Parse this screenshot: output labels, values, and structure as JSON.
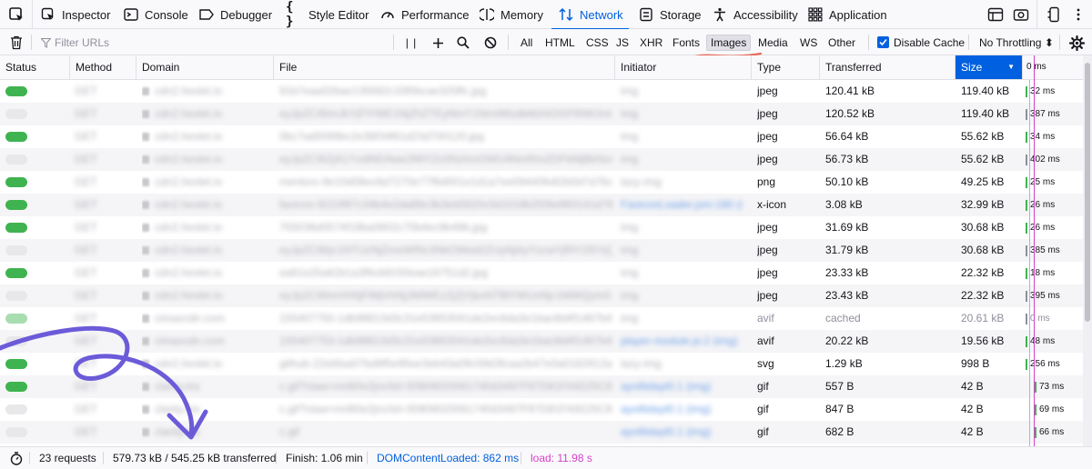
{
  "tabs": [
    {
      "label": "Inspector",
      "icon": "inspector-icon"
    },
    {
      "label": "Console",
      "icon": "console-icon"
    },
    {
      "label": "Debugger",
      "icon": "debugger-icon"
    },
    {
      "label": "Style Editor",
      "icon": "style-editor-icon"
    },
    {
      "label": "Performance",
      "icon": "performance-icon"
    },
    {
      "label": "Memory",
      "icon": "memory-icon"
    },
    {
      "label": "Network",
      "icon": "network-icon",
      "selected": true
    },
    {
      "label": "Storage",
      "icon": "storage-icon"
    },
    {
      "label": "Accessibility",
      "icon": "accessibility-icon"
    },
    {
      "label": "Application",
      "icon": "application-icon"
    }
  ],
  "toolbar": {
    "filter_placeholder": "Filter URLs",
    "type_filters": [
      "All",
      "HTML",
      "CSS",
      "JS",
      "XHR",
      "Fonts",
      "Images",
      "Media",
      "WS",
      "Other"
    ],
    "active_filter": "Images",
    "disable_cache_label": "Disable Cache",
    "disable_cache_checked": true,
    "throttling_label": "No Throttling ⬍"
  },
  "columns": {
    "status": "Status",
    "method": "Method",
    "domain": "Domain",
    "file": "File",
    "initiator": "Initiator",
    "type": "Type",
    "transferred": "Transferred",
    "size": "Size",
    "waterfall": "0 ms"
  },
  "colors": {
    "accent": "#0060df",
    "status_ok": "#3fb34f",
    "load_marker": "#d541c8",
    "dcl_marker": "#9db7f0",
    "annotation_arrow": "#6b5bd9",
    "annotation_underline": "#e86a5a"
  },
  "rows": [
    {
      "status": "green",
      "method": "GET",
      "domain": "cdn2.hexlet.io",
      "file": "91b7eaa02bae135692c33f0bcae325ffc.jpg",
      "initiator": "img",
      "initiator_link": false,
      "type": "jpeg",
      "transferred": "120.41 kB",
      "size": "119.40 kB",
      "time": "32 ms",
      "bar_color": "#3fb34f"
    },
    {
      "status": "grey",
      "method": "GET",
      "domain": "cdn2.hexlet.io",
      "file": "eyJpZCI6ImJkYjFlYWE1NjZhZTEyNmY1NmIiMzdkMzhiOGFlNWJmIn0.mpeeZjI",
      "initiator": "img",
      "initiator_link": false,
      "type": "jpeg",
      "transferred": "120.52 kB",
      "size": "119.40 kB",
      "time": "387 ms",
      "bar_color": "#8f8f9d"
    },
    {
      "status": "green",
      "method": "GET",
      "domain": "cdn2.hexlet.io",
      "file": "0bc7ad0099bc2e38f34f61d23d700120.jpg",
      "initiator": "img",
      "initiator_link": false,
      "type": "jpeg",
      "transferred": "56.64 kB",
      "size": "55.62 kB",
      "time": "34 ms",
      "bar_color": "#3fb34f"
    },
    {
      "status": "grey",
      "method": "GET",
      "domain": "cdn2.hexlet.io",
      "file": "eyJpZCI6ZjA1YzdlNDAwe2MiYZc0NzhmOWU4NmRmZDFkMjBkNzAxMzEzIn0.mpeeZjI",
      "initiator": "img",
      "initiator_link": false,
      "type": "jpeg",
      "transferred": "56.73 kB",
      "size": "55.62 kB",
      "time": "402 ms",
      "bar_color": "#8f8f9d"
    },
    {
      "status": "green",
      "method": "GET",
      "domain": "cdn2.hexlet.io",
      "file": "mentors-9e10d08ec6d7270e77f6d001e1d1a7ee09440fe82b0d7d76c2c2",
      "initiator": "lazy-img",
      "initiator_link": false,
      "type": "png",
      "transferred": "50.10 kB",
      "size": "49.25 kB",
      "time": "25 ms",
      "bar_color": "#3fb34f"
    },
    {
      "status": "green",
      "method": "GET",
      "domain": "cdn2.hexlet.io",
      "file": "favicon-9210f97c34b4e2da89c3b3eb5820c0d1018b2f26e993141d782e",
      "initiator": "FaviconLoader.jsm:180 (i",
      "initiator_link": true,
      "type": "x-icon",
      "transferred": "3.08 kB",
      "size": "32.99 kB",
      "time": "26 ms",
      "bar_color": "#3fb34f"
    },
    {
      "status": "green",
      "method": "GET",
      "domain": "cdn2.hexlet.io",
      "file": "755036d0574f18ba0602c70b4ec9b49b.jpg",
      "initiator": "img",
      "initiator_link": false,
      "type": "jpeg",
      "transferred": "31.69 kB",
      "size": "30.68 kB",
      "time": "26 ms",
      "bar_color": "#3fb34f"
    },
    {
      "status": "grey",
      "method": "GET",
      "domain": "cdn2.hexlet.io",
      "file": "eyJpZCI6Ijc1NTUzNjZmeWRlc3NkOWed2ZUyNjAyYzcwYjRlY2I5YjQ5YiIn0.mpeeZjI",
      "initiator": "img",
      "initiator_link": false,
      "type": "jpeg",
      "transferred": "31.79 kB",
      "size": "30.68 kB",
      "time": "385 ms",
      "bar_color": "#8f8f9d"
    },
    {
      "status": "green",
      "method": "GET",
      "domain": "cdn2.hexlet.io",
      "file": "ea61e25a62b1a3f6cb9150eae16751d2.jpg",
      "initiator": "img",
      "initiator_link": false,
      "type": "jpeg",
      "transferred": "23.33 kB",
      "size": "22.32 kB",
      "time": "18 ms",
      "bar_color": "#3fb34f"
    },
    {
      "status": "grey",
      "method": "GET",
      "domain": "cdn2.hexlet.io",
      "file": "eyJpZCI6ImVhNjFlMjVhNjJiMWEzZjZjYjkxNTBlYWUxNjc1MWQyIn0.mpeeZjI",
      "initiator": "img",
      "initiator_link": false,
      "type": "jpeg",
      "transferred": "23.43 kB",
      "size": "22.32 kB",
      "time": "395 ms",
      "bar_color": "#8f8f9d"
    },
    {
      "status": "green-faded",
      "method": "GET",
      "domain": "cimaxcdn.com",
      "file": "155407750-1db98813d3c31e53853041de2ec6da3e1bac8d4f1467b4f49",
      "initiator": "img",
      "initiator_link": false,
      "type": "avif",
      "transferred": "cached",
      "size": "20.61 kB",
      "time": "0 ms",
      "bar_color": "#8f8f9d",
      "muted": true
    },
    {
      "status": "grey",
      "method": "GET",
      "domain": "cimaxcdn.com",
      "file": "155407753-1db98813d3c31e53853041de2ec6da3e1bac8d4f1467b4f49",
      "initiator": "player-module.js:2 (img)",
      "initiator_link": true,
      "type": "avif",
      "transferred": "20.22 kB",
      "size": "19.56 kB",
      "time": "48 ms",
      "bar_color": "#3fb34f"
    },
    {
      "status": "green",
      "method": "GET",
      "domain": "cdn2.hexlet.io",
      "file": "github-22ebfaa07bd9f5e95ee3eb43a09c59d3fcaa2b47e0a0182912ac16",
      "initiator": "lazy-img",
      "initiator_link": false,
      "type": "svg",
      "transferred": "1.29 kB",
      "size": "998 B",
      "time": "256 ms",
      "bar_color": "#3fb34f"
    },
    {
      "status": "green",
      "method": "GET",
      "domain": "clarity.ms",
      "file": "c.gif?ctaw=mr8i0e2jnc0d=30909020061740d3497F87D81FA9225C8AR0",
      "initiator": "ayo6tdayt0.1 (img)",
      "initiator_link": true,
      "type": "gif",
      "transferred": "557 B",
      "size": "42 B",
      "time": "73 ms",
      "bar_color": "#3fb34f"
    },
    {
      "status": "grey",
      "method": "GET",
      "domain": "clarity.ms",
      "file": "c.gif?ctaw=mr8i0e2jnc0d=30909020061740d3497F87D81FA9225C8AR0",
      "initiator": "ayo6tdayt0.1 (img)",
      "initiator_link": true,
      "type": "gif",
      "transferred": "847 B",
      "size": "42 B",
      "time": "69 ms",
      "bar_color": "#3fb34f"
    },
    {
      "status": "grey",
      "method": "GET",
      "domain": "clarity.ms",
      "file": "c.gif",
      "initiator": "ayo6tdayt0.1 (img)",
      "initiator_link": true,
      "type": "gif",
      "transferred": "682 B",
      "size": "42 B",
      "time": "66 ms",
      "bar_color": "#3fb34f"
    }
  ],
  "statusbar": {
    "requests": "23 requests",
    "transferred": "579.73 kB / 545.25 kB transferred",
    "finish": "Finish: 1.06 min",
    "dom_content_loaded": "DOMContentLoaded: 862 ms",
    "load": "load: 11.98 s"
  }
}
